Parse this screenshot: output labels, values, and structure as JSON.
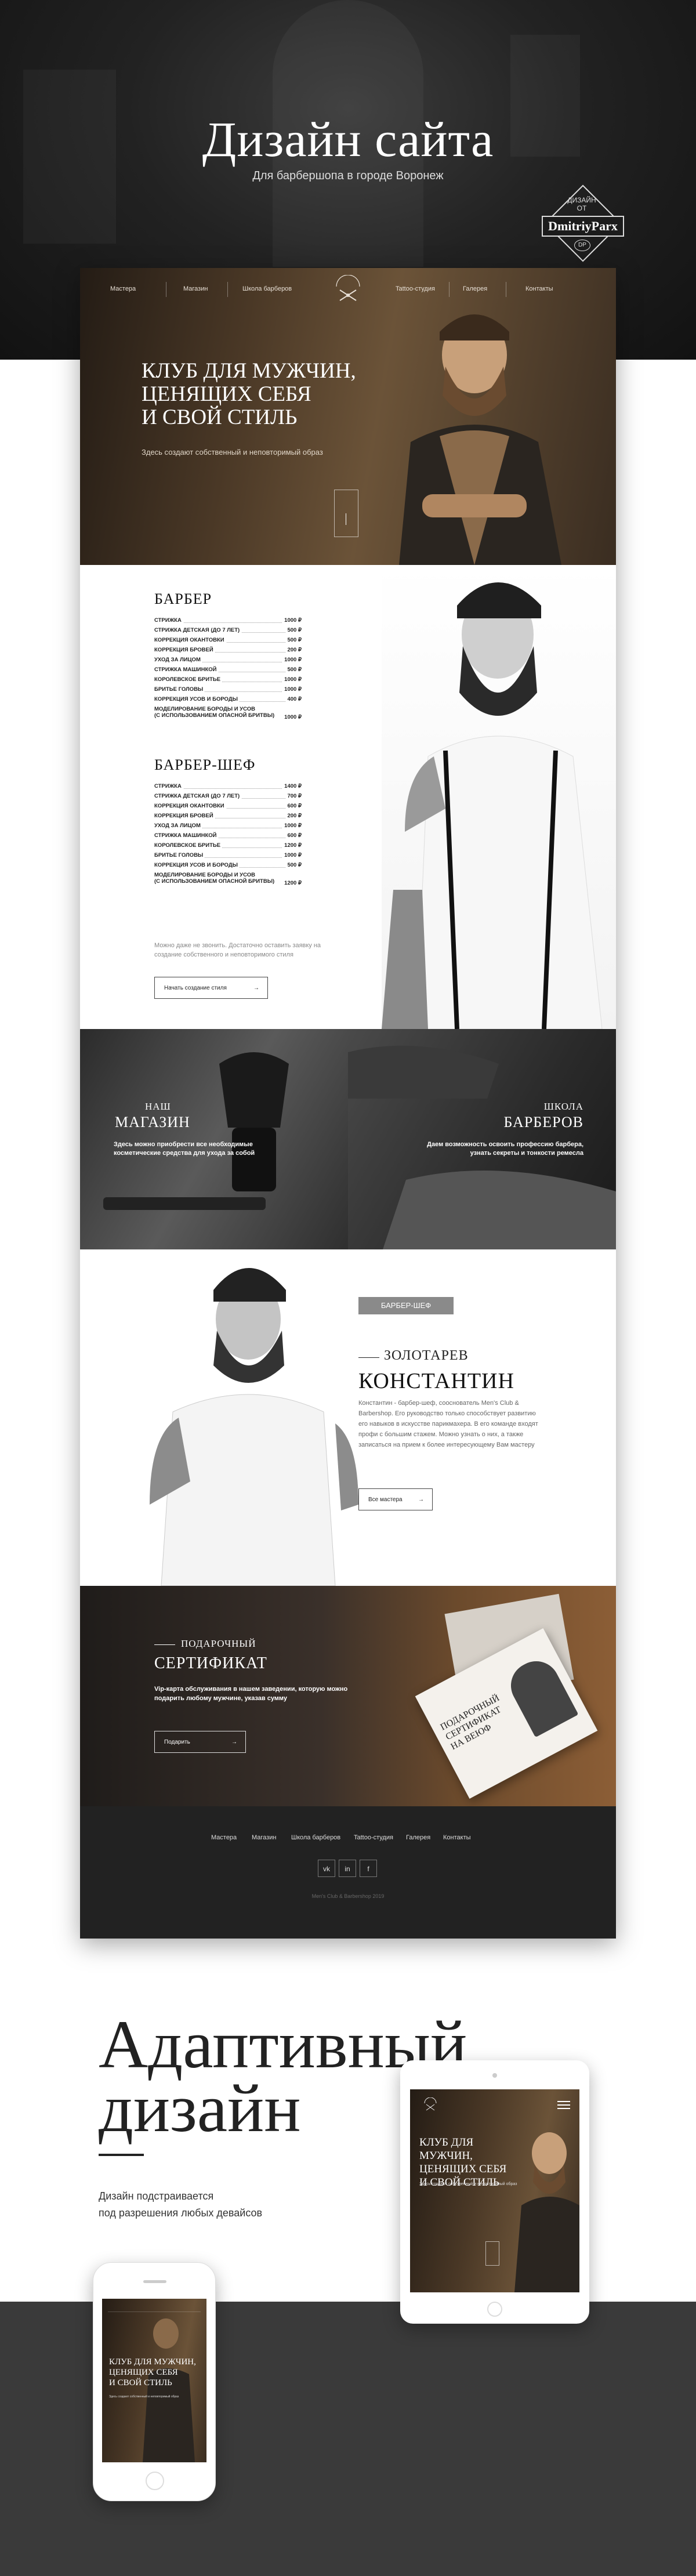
{
  "header": {
    "title": "Дизайн сайта",
    "subtitle": "Для барбершопа в городе Воронеж",
    "badge_small": "ДИЗАЙН\nОТ",
    "badge_name": "DmitriyParx",
    "badge_mono": "DP"
  },
  "site": {
    "nav": [
      "Мастера",
      "Магазин",
      "Школа барберов",
      "Tattoo-студия",
      "Галерея",
      "Контакты"
    ],
    "logo_text": "BARBER",
    "hero": {
      "title": "КЛУБ ДЛЯ МУЖЧИН,\nЦЕНЯЩИХ СЕБЯ\nИ СВОЙ СТИЛЬ",
      "subtitle": "Здесь создают собственный и неповторимый образ"
    },
    "barber": {
      "heading": "БАРБЕР",
      "items": [
        {
          "name": "СТРИЖКА",
          "price": "1000 ₽"
        },
        {
          "name": "СТРИЖКА ДЕТСКАЯ (ДО 7 ЛЕТ)",
          "price": "500 ₽"
        },
        {
          "name": "КОРРЕКЦИЯ ОКАНТОВКИ",
          "price": "500 ₽"
        },
        {
          "name": "КОРРЕКЦИЯ БРОВЕЙ",
          "price": "200 ₽"
        },
        {
          "name": "УХОД ЗА ЛИЦОМ",
          "price": "1000 ₽"
        },
        {
          "name": "СТРИЖКА МАШИНКОЙ",
          "price": "500 ₽"
        },
        {
          "name": "КОРОЛЕВСКОЕ БРИТЬЕ",
          "price": "1000 ₽"
        },
        {
          "name": "БРИТЬЕ ГОЛОВЫ",
          "price": "1000 ₽"
        },
        {
          "name": "КОРРЕКЦИЯ УСОВ И БОРОДЫ",
          "price": "400 ₽"
        },
        {
          "name": "МОДЕЛИРОВАНИЕ БОРОДЫ И УСОВ\n(С ИСПОЛЬЗОВАНИЕМ ОПАСНОЙ БРИТВЫ)",
          "price": "1000 ₽"
        }
      ]
    },
    "chief": {
      "heading": "БАРБЕР-ШЕФ",
      "items": [
        {
          "name": "СТРИЖКА",
          "price": "1400 ₽"
        },
        {
          "name": "СТРИЖКА ДЕТСКАЯ (ДО 7 ЛЕТ)",
          "price": "700 ₽"
        },
        {
          "name": "КОРРЕКЦИЯ ОКАНТОВКИ",
          "price": "600 ₽"
        },
        {
          "name": "КОРРЕКЦИЯ БРОВЕЙ",
          "price": "200 ₽"
        },
        {
          "name": "УХОД ЗА ЛИЦОМ",
          "price": "1000 ₽"
        },
        {
          "name": "СТРИЖКА МАШИНКОЙ",
          "price": "600 ₽"
        },
        {
          "name": "КОРОЛЕВСКОЕ БРИТЬЕ",
          "price": "1200 ₽"
        },
        {
          "name": "БРИТЬЕ ГОЛОВЫ",
          "price": "1000 ₽"
        },
        {
          "name": "КОРРЕКЦИЯ УСОВ И БОРОДЫ",
          "price": "500 ₽"
        },
        {
          "name": "МОДЕЛИРОВАНИЕ БОРОДЫ И УСОВ\n(С ИСПОЛЬЗОВАНИЕМ ОПАСНОЙ БРИТВЫ)",
          "price": "1200 ₽"
        }
      ]
    },
    "price_note": "Можно даже не звонить. Достаточно оставить заявку на создание собственного и неповторимого стиля",
    "price_button": "Начать создание стиля",
    "shop": {
      "small": "НАШ",
      "title": "МАГАЗИН",
      "text": "Здесь можно приобрести все необходимые косметические средства для ухода за собой"
    },
    "school": {
      "small": "ШКОЛА",
      "title": "БАРБЕРОВ",
      "text": "Даем возможность освоить профессию барбера, узнать секреты и тонкости ремесла"
    },
    "master": {
      "badge": "БАРБЕР-ШЕФ",
      "first": "ЗОЛОТАРЕВ",
      "last": "КОНСТАНТИН",
      "text": "Константин - барбер-шеф, сооснователь Men's Club & Barbershop. Его руководство только способствует развитию его навыков в искусстве парикмахера. В его команде входят профи с большим стажем. Можно узнать о них, а также записаться на прием к более интересующему Вам мастеру",
      "button": "Все мастера"
    },
    "certificate": {
      "small": "ПОДАРОЧНЫЙ",
      "title": "СЕРТИФИКАТ",
      "text": "Vip-карта обслуживания в нашем заведении, которую можно подарить любому мужчине, указав сумму",
      "button": "Подарить",
      "card_text": "ПОДАРОЧНЫЙ СЕРТИФИКАТ НА ВЕЮФ"
    },
    "footer": {
      "nav": [
        "Мастера",
        "Магазин",
        "Школа барберов",
        "Tattoo-студия",
        "Галерея",
        "Контакты"
      ],
      "socials": [
        "vk",
        "in",
        "f"
      ],
      "copyright": "Men's Club & Barbershop 2019"
    }
  },
  "adaptive": {
    "title": "Адаптивный\nдизайн",
    "text": "Дизайн подстраивается\nпод разрешения любых девайсов",
    "tablet_title": "КЛУБ ДЛЯ МУЖЧИН,\nЦЕНЯЩИХ СЕБЯ\nИ СВОЙ СТИЛЬ",
    "tablet_sub": "Здесь создают собственный и неповторимый образ",
    "phone_title": "КЛУБ ДЛЯ МУЖЧИН,\nЦЕНЯЩИХ СЕБЯ\nИ СВОЙ СТИЛЬ",
    "phone_sub": "Здесь создают собственный и неповторимый образ"
  },
  "colors": {
    "dark": "#222222",
    "accent_gray": "#8a8a8a",
    "warm_brown": "#6b5338"
  }
}
